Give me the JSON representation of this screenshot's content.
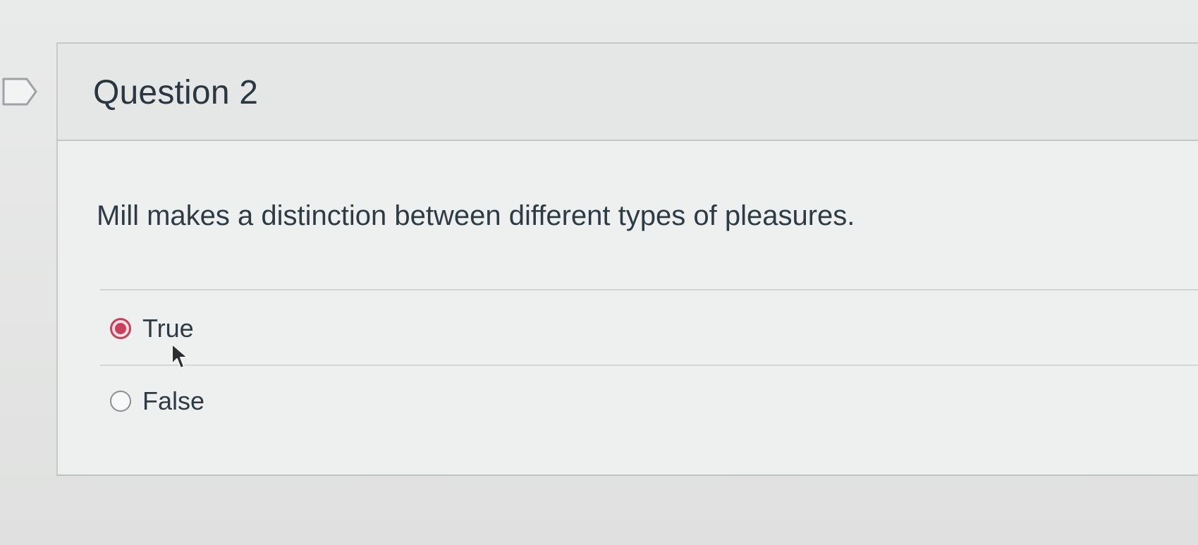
{
  "question": {
    "title": "Question 2",
    "text": "Mill makes a distinction between different types of pleasures.",
    "answers": [
      {
        "label": "True",
        "selected": true
      },
      {
        "label": "False",
        "selected": false
      }
    ]
  },
  "icons": {
    "flag": "flag-icon",
    "cursor": "mouse-pointer-icon"
  },
  "colors": {
    "selected_radio": "#c8405a",
    "text": "#2d3b45"
  }
}
